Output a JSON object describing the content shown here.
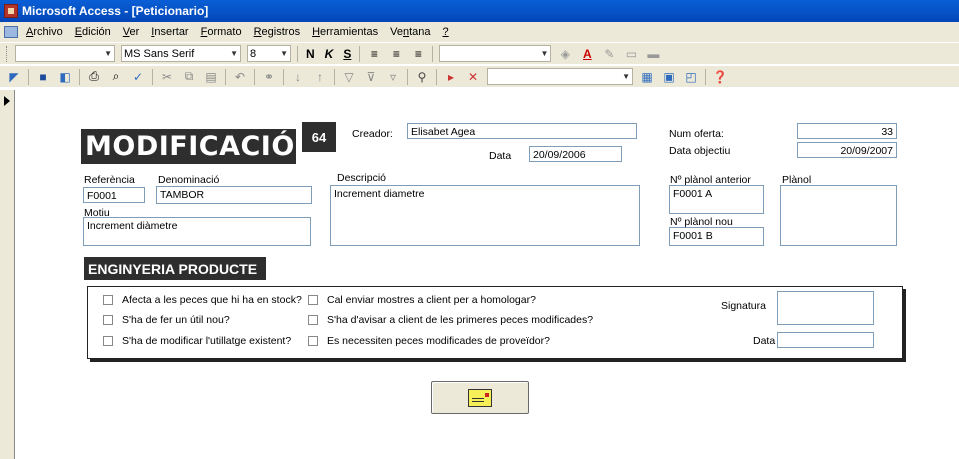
{
  "window": {
    "title": "Microsoft Access - [Peticionario]"
  },
  "menu": [
    {
      "pre": "",
      "ul": "A",
      "post": "rchivo"
    },
    {
      "pre": "",
      "ul": "E",
      "post": "dición"
    },
    {
      "pre": "",
      "ul": "V",
      "post": "er"
    },
    {
      "pre": "",
      "ul": "I",
      "post": "nsertar"
    },
    {
      "pre": "",
      "ul": "F",
      "post": "ormato"
    },
    {
      "pre": "",
      "ul": "R",
      "post": "egistros"
    },
    {
      "pre": "",
      "ul": "H",
      "post": "erramientas"
    },
    {
      "pre": "Ve",
      "ul": "n",
      "post": "tana"
    },
    {
      "pre": "",
      "ul": "?",
      "post": ""
    }
  ],
  "formatting_toolbar": {
    "object_combo": "",
    "font": "MS Sans Serif",
    "size": "8",
    "bold": "N",
    "italic": "K",
    "underline": "S",
    "font_color_letter": "A"
  },
  "form": {
    "title": "MODIFICACIÓ",
    "number": "64",
    "creador_label": "Creador:",
    "creador": "Elisabet Agea",
    "data_label": "Data",
    "data": "20/09/2006",
    "num_oferta_label": "Num oferta:",
    "num_oferta": "33",
    "data_objectiu_label": "Data objectiu",
    "data_objectiu": "20/09/2007",
    "referencia_label": "Referència",
    "referencia": "F0001",
    "denominacio_label": "Denominació",
    "denominacio": "TAMBOR",
    "motiu_label": "Motiu",
    "motiu": "Increment diàmetre",
    "descripcio_label": "Descripció",
    "descripcio": "Increment diametre",
    "planol_anterior_label": "Nº plànol anterior",
    "planol_anterior": "F0001 A",
    "planol_nou_label": "Nº plànol nou",
    "planol_nou": "F0001 B",
    "planol_label": "Plànol",
    "planol": ""
  },
  "enginyeria": {
    "title": "ENGINYERIA PRODUCTE",
    "checks_left": [
      "Afecta a les peces que hi ha en stock?",
      "S'ha de fer un útil nou?",
      "S'ha de modificar l'utillatge existent?"
    ],
    "checks_right": [
      "Cal enviar mostres a client per a homologar?",
      "S'ha d'avisar a client de les primeres peces modificades?",
      "Es necessiten peces modificades de proveïdor?"
    ],
    "signatura_label": "Signatura",
    "signatura": "",
    "data_label": "Data",
    "data": ""
  },
  "icons": {
    "action_button": "send-mail-icon"
  }
}
